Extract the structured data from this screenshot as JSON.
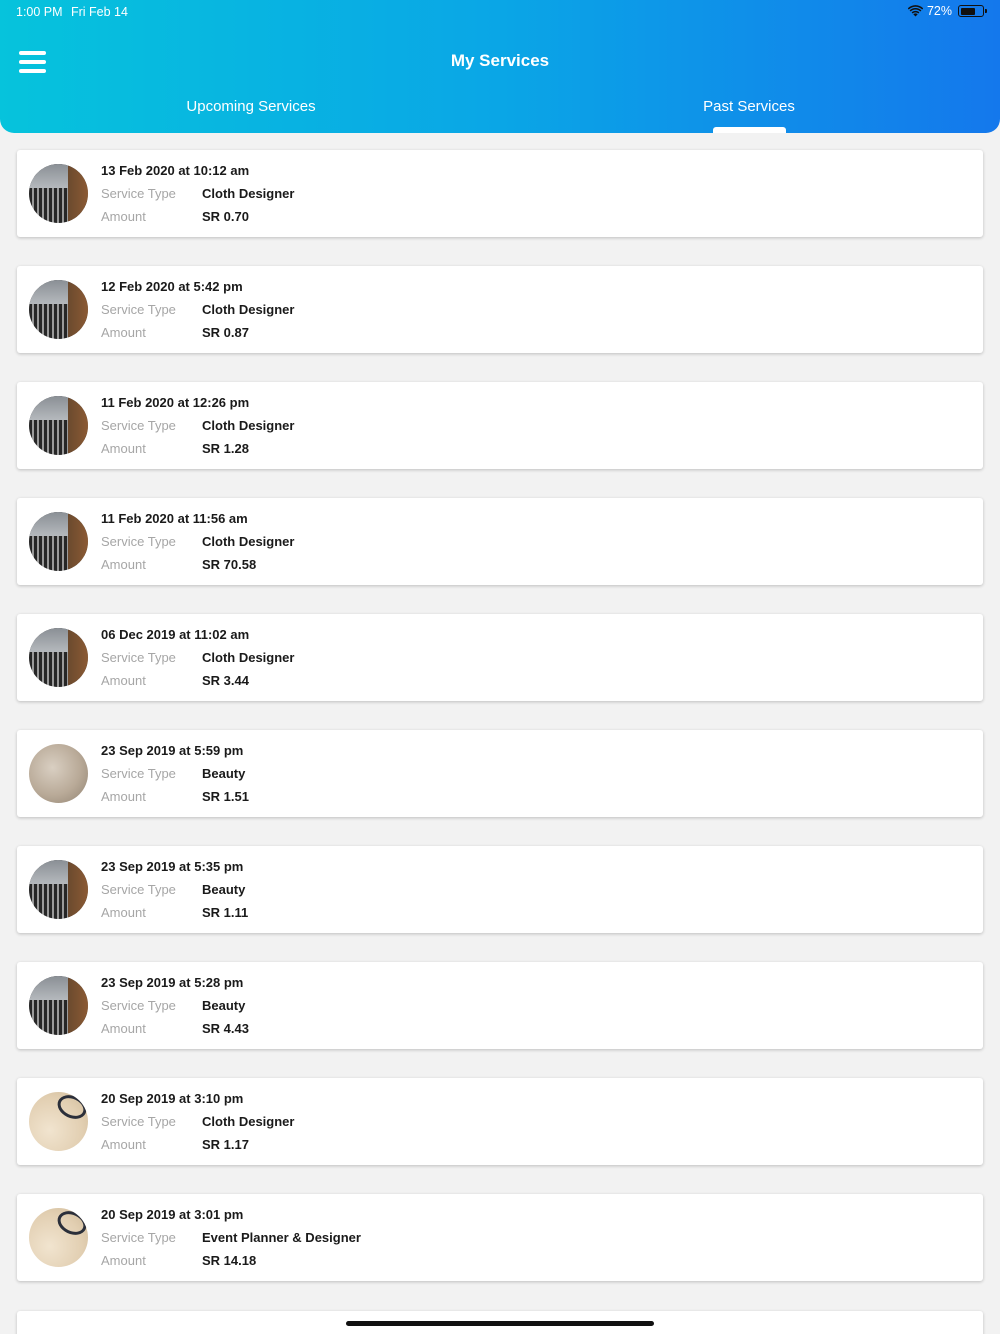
{
  "status_bar": {
    "time": "1:00 PM",
    "date": "Fri Feb 14",
    "battery": "72%",
    "battery_level": 0.72
  },
  "header": {
    "title": "My Services",
    "menu_icon": "hamburger-menu-icon"
  },
  "tabs": [
    {
      "label": "Upcoming Services",
      "active": false
    },
    {
      "label": "Past Services",
      "active": true
    }
  ],
  "labels": {
    "service_type": "Service Type",
    "amount": "Amount"
  },
  "services": [
    {
      "date": "13 Feb 2020 at 10:12 am",
      "service_type": "Cloth Designer",
      "amount": "SR 0.70",
      "thumb": "laptop"
    },
    {
      "date": "12 Feb 2020 at 5:42 pm",
      "service_type": "Cloth Designer",
      "amount": "SR 0.87",
      "thumb": "laptop"
    },
    {
      "date": "11 Feb 2020 at 12:26 pm",
      "service_type": "Cloth Designer",
      "amount": "SR 1.28",
      "thumb": "laptop"
    },
    {
      "date": "11 Feb 2020 at 11:56 am",
      "service_type": "Cloth Designer",
      "amount": "SR 70.58",
      "thumb": "laptop"
    },
    {
      "date": "06 Dec 2019 at 11:02 am",
      "service_type": "Cloth Designer",
      "amount": "SR 3.44",
      "thumb": "laptop"
    },
    {
      "date": "23 Sep 2019 at 5:59 pm",
      "service_type": "Beauty",
      "amount": "SR 1.51",
      "thumb": "fabric"
    },
    {
      "date": "23 Sep 2019 at 5:35 pm",
      "service_type": "Beauty",
      "amount": "SR 1.11",
      "thumb": "laptop"
    },
    {
      "date": "23 Sep 2019 at 5:28 pm",
      "service_type": "Beauty",
      "amount": "SR 4.43",
      "thumb": "laptop"
    },
    {
      "date": "20 Sep 2019 at 3:10 pm",
      "service_type": "Cloth Designer",
      "amount": "SR 1.17",
      "thumb": "desk"
    },
    {
      "date": "20 Sep 2019 at 3:01 pm",
      "service_type": "Event Planner & Designer",
      "amount": "SR 14.18",
      "thumb": "desk"
    }
  ],
  "colors": {
    "header_start": "#06c3dc",
    "header_end": "#1478ec",
    "label_gray": "#a6a6a6",
    "background": "#f2f2f2"
  }
}
